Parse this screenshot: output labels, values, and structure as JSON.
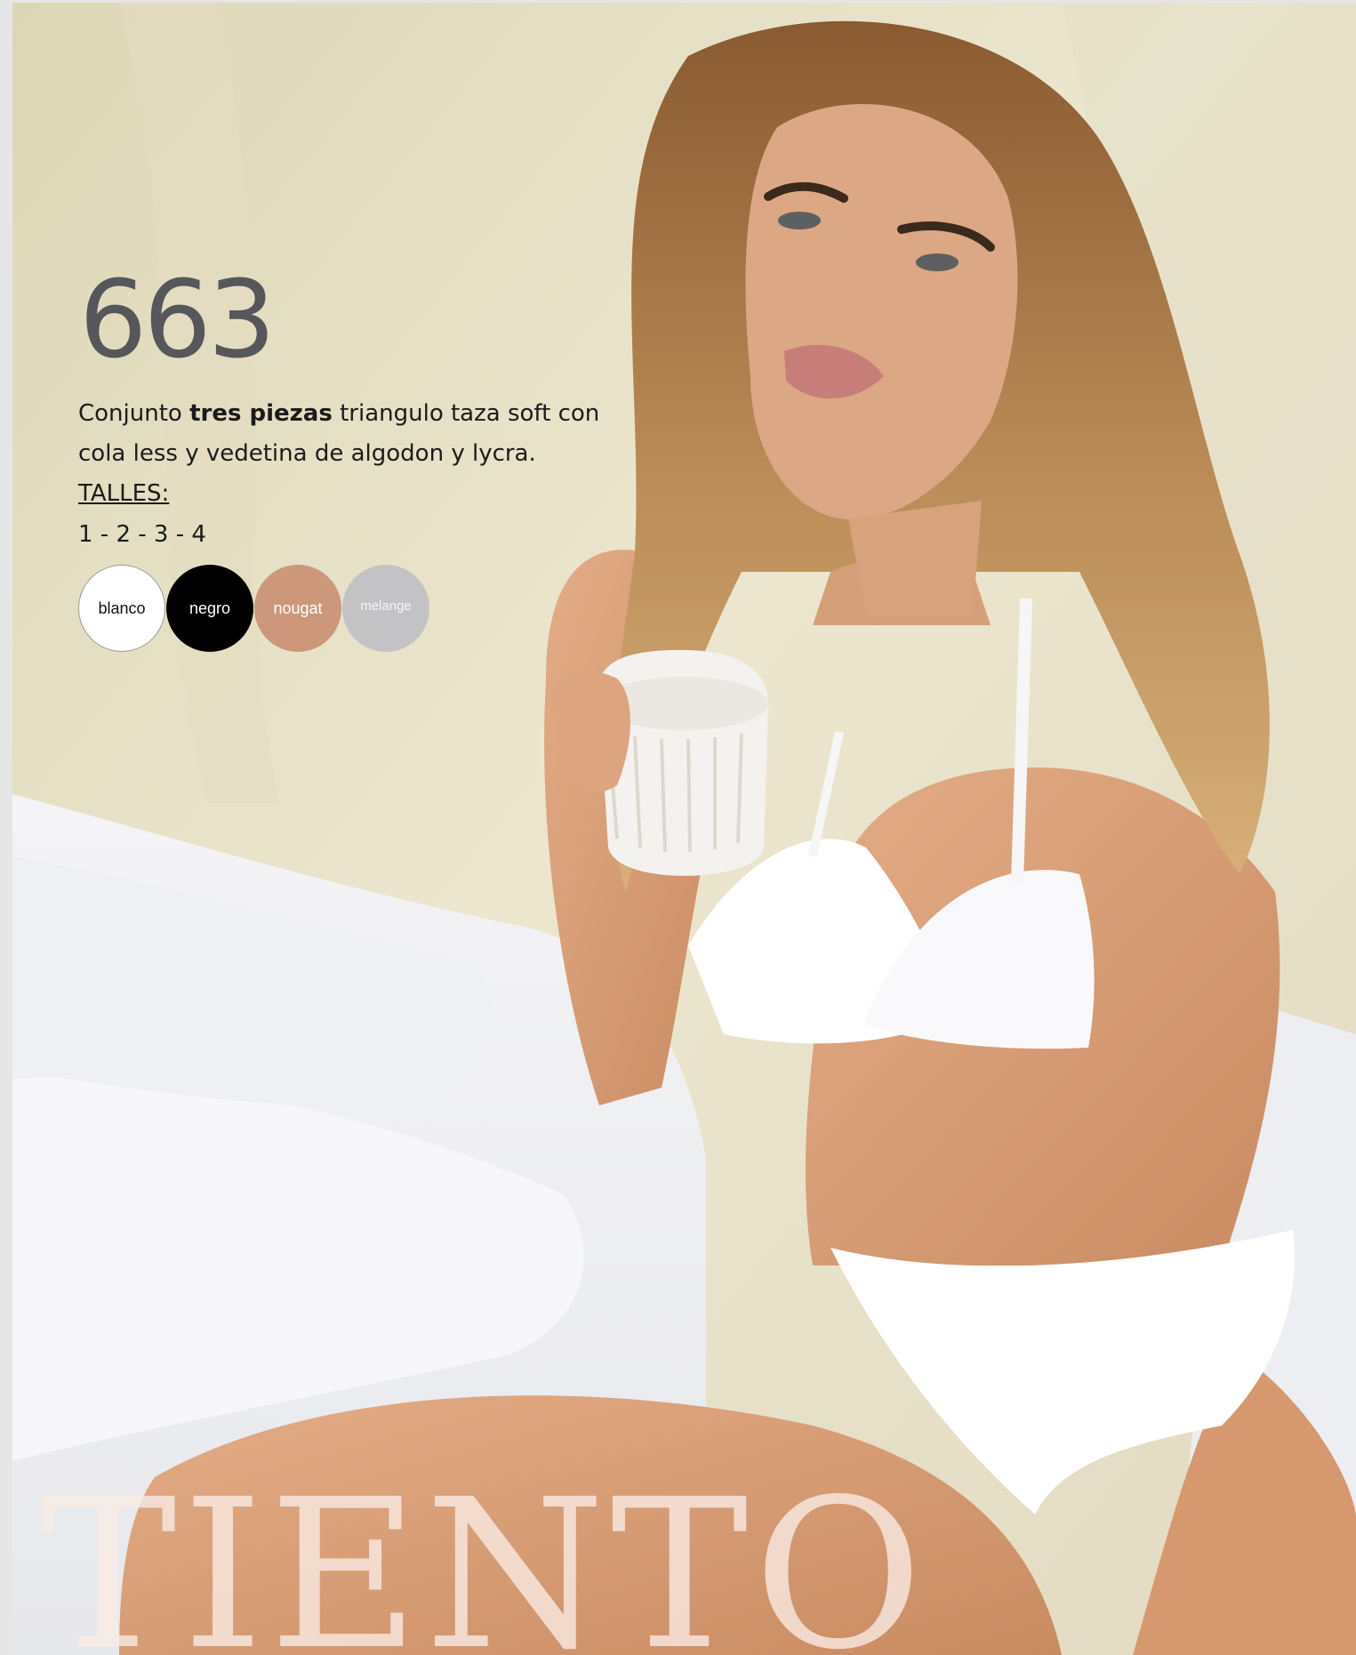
{
  "product": {
    "model_number": "663",
    "description_prefix": "Conjunto ",
    "description_bold": "tres piezas",
    "description_suffix": " triangulo taza soft con cola less y vedetina de algodon y lycra.",
    "sizes_label": "TALLES:",
    "sizes_values": "1 - 2 - 3 - 4",
    "colors": [
      {
        "label": "blanco",
        "hex": "#ffffff"
      },
      {
        "label": "negro",
        "hex": "#000000"
      },
      {
        "label": "nougat",
        "hex": "#cc977a"
      },
      {
        "label": "melange",
        "hex": "#c3c3c6"
      }
    ]
  },
  "brand": {
    "name": "TIENTO"
  },
  "photo": {
    "subject": "model-in-white-lingerie-holding-cup",
    "colors": {
      "wall": "#e9e1c6",
      "bedding": "#f1f2f4",
      "skin": "#d79f7a",
      "hair": "#a6703d"
    }
  }
}
